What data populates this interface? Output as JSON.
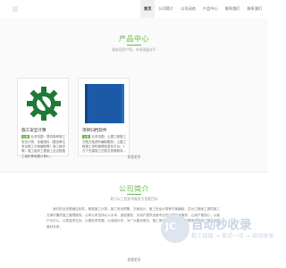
{
  "nav": {
    "items": [
      {
        "label": "首页",
        "active": true
      },
      {
        "label": "公司简介",
        "active": false
      },
      {
        "label": "公司动态",
        "active": false
      },
      {
        "label": "产品中心",
        "active": false
      },
      {
        "label": "联系我们",
        "active": false
      },
      {
        "label": "联系我们",
        "active": false
      }
    ]
  },
  "products": {
    "title": "产品中心",
    "subtitle": "服务项目介绍，市场发展水平",
    "cards": [
      {
        "title": "施工安全计算",
        "tag": "公告",
        "desc": "业务范围：提供各种施工安全计算、全套投标（建设单位安全施工方案编制等）施工组织等）施工组织工程施工全过程施工组织等成果计算A..."
      },
      {
        "title": "项目归档软件",
        "tag": "公告",
        "desc": "业务范围：土建工程施工归档文档资料编制服务；土建工程施工资料管理信息化平台，1万个先建施工归档文档等服务..."
      }
    ],
    "more_label": "查看更多"
  },
  "about": {
    "title": "公司简介",
    "subtitle": "致力以工程技术服务为首要目标",
    "text": "我们的业务是通过软件，精准施工计算、施工安全预警、方案设计、施工安全计算等方案编制，并为工程施工提供施工方案可靠的施工管理服务。公司以来坚持以人为本，诚信服务，为用户提供全面专业的工程技术服务，让用户更放心；以客户为中心，以质量求生存，以服务求发展，以诚信为本，为广大建设单位、施工单位提供可靠的技术服务与支持，携手共创美好未来。",
    "more_label": "查看更多"
  },
  "watermark": {
    "letters": "JC",
    "main": "自动秒收录",
    "sub": "数上链接 → 来访一次 → 自动收录"
  },
  "colors": {
    "accent": "#67b84a",
    "card_blue": "#1c5aa8"
  }
}
